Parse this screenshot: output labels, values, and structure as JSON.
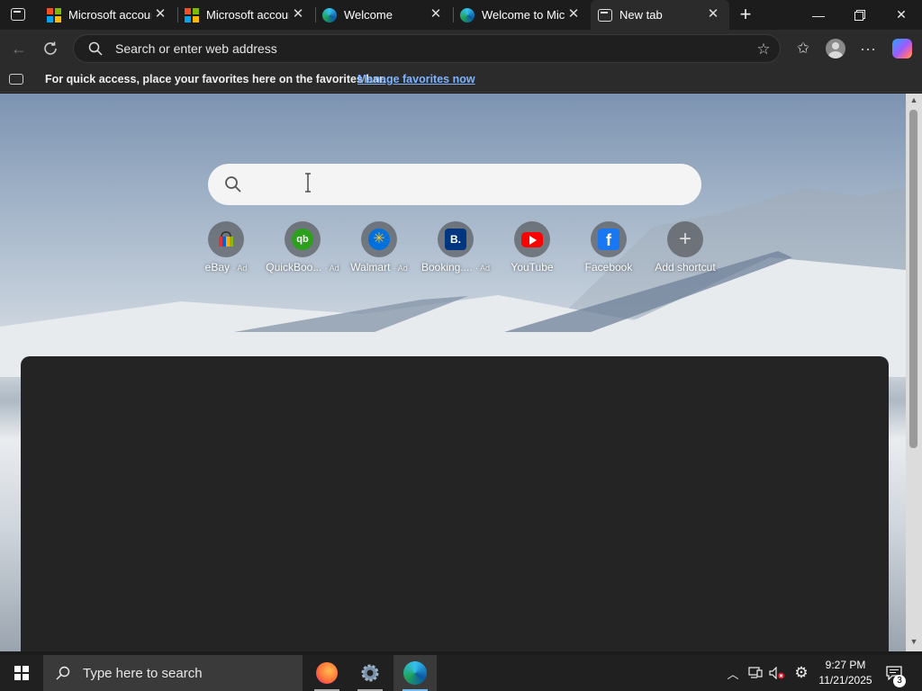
{
  "tabs": [
    {
      "title": "Microsoft accoun",
      "icon": "microsoft-logo-icon",
      "active": false
    },
    {
      "title": "Microsoft accoun",
      "icon": "microsoft-logo-icon",
      "active": false
    },
    {
      "title": "Welcome",
      "icon": "edge-logo-icon",
      "active": false
    },
    {
      "title": "Welcome to Micr",
      "icon": "edge-logo-icon",
      "active": false
    },
    {
      "title": "New tab",
      "icon": "new-tab-page-icon",
      "active": true
    }
  ],
  "address_bar": {
    "placeholder": "Search or enter web address"
  },
  "favorites_bar": {
    "message": "For quick access, place your favorites here on the favorites bar.",
    "link": "Manage favorites now"
  },
  "shortcuts": [
    {
      "label": "eBay",
      "ad": "· Ad",
      "icon": "ebay-icon",
      "color": "#3a3a3a"
    },
    {
      "label": "QuickBoo...",
      "ad": "· Ad",
      "icon": "quickbooks-icon",
      "color": "#2ca01c"
    },
    {
      "label": "Walmart",
      "ad": "· Ad",
      "icon": "walmart-icon",
      "color": "#0071dc"
    },
    {
      "label": "Booking....",
      "ad": "· Ad",
      "icon": "booking-icon",
      "color": "#003580"
    },
    {
      "label": "YouTube",
      "ad": "",
      "icon": "youtube-icon",
      "color": "#ff0000"
    },
    {
      "label": "Facebook",
      "ad": "",
      "icon": "facebook-icon",
      "color": "#1877f2"
    },
    {
      "label": "Add shortcut",
      "ad": "",
      "icon": "plus-icon",
      "color": "#cccccc"
    }
  ],
  "taskbar": {
    "search_placeholder": "Type here to search",
    "time": "9:27 PM",
    "date": "11/21/2025",
    "notification_count": "3"
  },
  "colors": {
    "accent": "#0078d4",
    "link": "#7fb3ff",
    "tab_bar": "#1c1c1c",
    "toolbar": "#2b2b2b"
  }
}
